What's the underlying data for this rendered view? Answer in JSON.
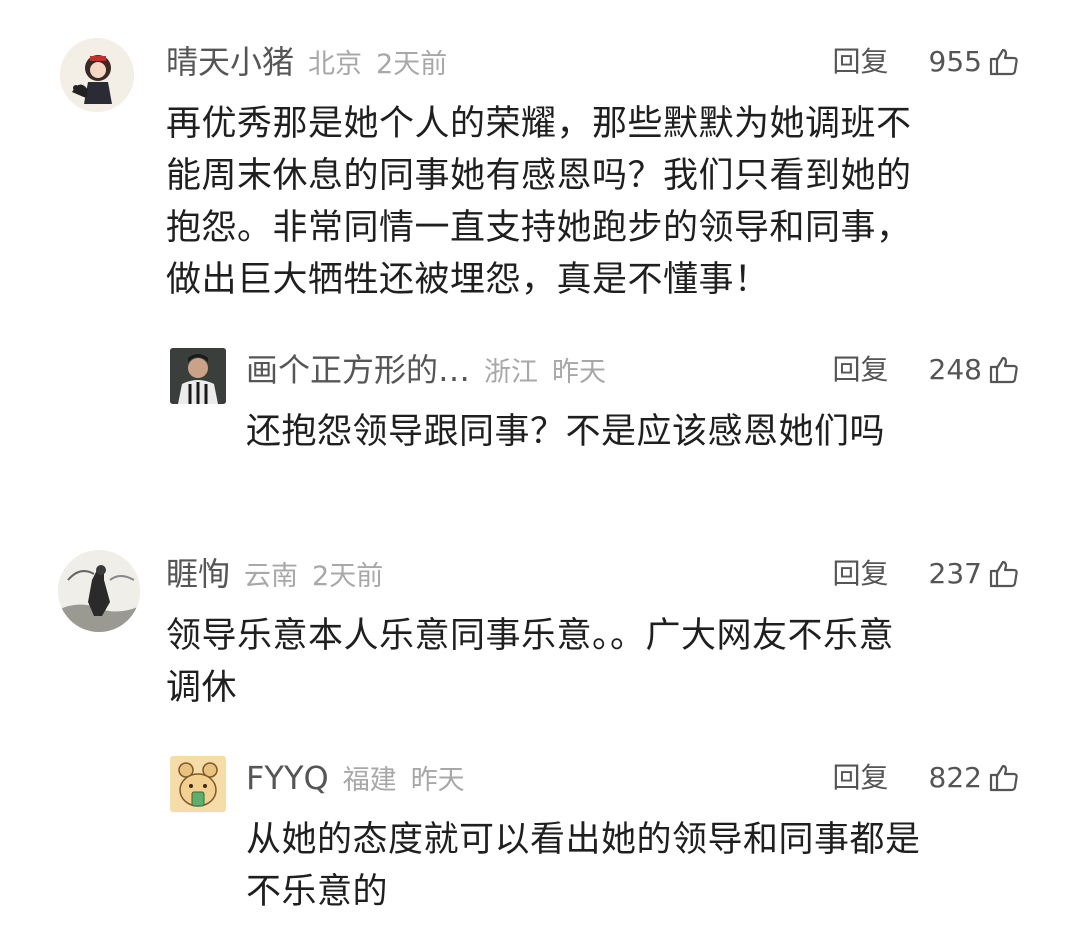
{
  "comments": [
    {
      "username": "晴天小猪",
      "location": "北京",
      "time": "2天前",
      "reply_label": "回复",
      "likes": "955",
      "lines": [
        "再优秀那是她个人的荣耀，那些默默为她调班不",
        "能周末休息的同事她有感恩吗？我们只看到她的",
        "抱怨。非常同情一直支持她跑步的领导和同事，",
        "做出巨大牺牲还被埋怨，真是不懂事！"
      ],
      "replies": [
        {
          "username": "画个正方形的…",
          "location": "浙江",
          "time": "昨天",
          "reply_label": "回复",
          "likes": "248",
          "lines": [
            "还抱怨领导跟同事？不是应该感恩她们吗"
          ]
        }
      ]
    },
    {
      "username": "睚恂",
      "location": "云南",
      "time": "2天前",
      "reply_label": "回复",
      "likes": "237",
      "lines": [
        "领导乐意本人乐意同事乐意。。广大网友不乐意",
        "调休"
      ],
      "replies": [
        {
          "username": "FYYQ",
          "location": "福建",
          "time": "昨天",
          "reply_label": "回复",
          "likes": "822",
          "lines": [
            "从她的态度就可以看出她的领导和同事都是",
            "不乐意的"
          ]
        }
      ]
    }
  ],
  "icons": {
    "like": "thumbs-up-icon"
  }
}
